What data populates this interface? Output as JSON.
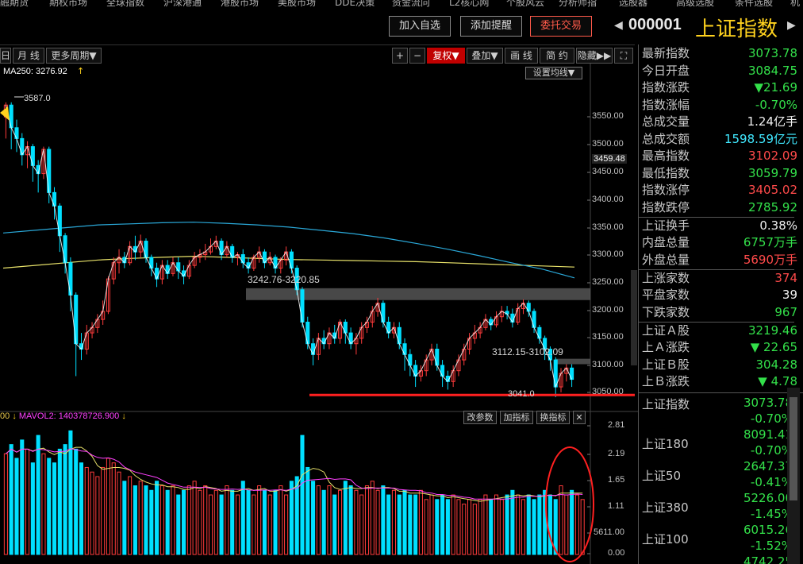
{
  "top_menu": [
    "融期货",
    "期权市场",
    "全球指数",
    "沪深港通",
    "港股市场",
    "美股市场",
    "DDE决策",
    "资金流向",
    "L2核心网",
    "个股风云",
    "分析师指",
    "选股器",
    "高级选股",
    "条件选股",
    "机"
  ],
  "header": {
    "buttons": [
      "加入自选",
      "添加提醒",
      "委托交易"
    ],
    "index_code": "000001",
    "index_name": "上证指数",
    "nav_prev": "◀",
    "nav_next": "▶"
  },
  "toolbar": {
    "left_items": [
      "日",
      "月 线",
      "更多周期▼"
    ],
    "right_items": [
      "+",
      "−",
      "复权▼",
      "叠加▼",
      "画 线",
      "简 约",
      "隐藏▶▶",
      "⛶"
    ],
    "active": "复权▼"
  },
  "ma": {
    "label": "MA250: 3276.92",
    "arrow": "↑",
    "settings_button": "设置均线▼"
  },
  "price_axis": [
    "3550.00",
    "3500.00",
    "3459.48",
    "3450.00",
    "3400.00",
    "3350.00",
    "3300.00",
    "3250.00",
    "3200.00",
    "3150.00",
    "3100.00",
    "3050.00"
  ],
  "annotations": {
    "high": "3587.0",
    "box_upper": "3242.76-3220.85",
    "box_lower": "3112.15-3102.09",
    "low": "3041.0"
  },
  "volume": {
    "header_prefix": "00",
    "header_arrow1": "↓",
    "header_label": "MAVOL2: 140378726.900",
    "header_arrow2": "↓",
    "buttons": [
      "改参数",
      "加指标",
      "换指标",
      "✕"
    ],
    "axis": [
      "2.81",
      "2.19",
      "1.65",
      "1.11",
      "5611.00",
      "0.00"
    ]
  },
  "colors": {
    "up": "#ff3b3b",
    "down": "#00e0ff",
    "ma_yellow": "#e8e26a",
    "ma_cyan": "#2aa8d8",
    "panel_up": "#ff4a4a",
    "panel_down": "#33e04a"
  },
  "panel": {
    "rows": [
      {
        "label": "最新指数",
        "value": "3073.78",
        "color": "down"
      },
      {
        "label": "今日开盘",
        "value": "3084.75",
        "color": "down"
      },
      {
        "label": "指数涨跌",
        "value": "▼21.69",
        "color": "down"
      },
      {
        "label": "指数涨幅",
        "value": "-0.70%",
        "color": "down"
      },
      {
        "label": "总成交量",
        "value": "1.24亿手",
        "color": "white"
      },
      {
        "label": "总成交额",
        "value": "1598.59亿元",
        "color": "cyan"
      },
      {
        "label": "最高指数",
        "value": "3102.09",
        "color": "up"
      },
      {
        "label": "最低指数",
        "value": "3059.79",
        "color": "down"
      },
      {
        "label": "指数涨停",
        "value": "3405.02",
        "color": "up"
      },
      {
        "label": "指数跌停",
        "value": "2785.92",
        "color": "down"
      },
      {
        "label": "上证换手",
        "value": "0.38%",
        "color": "white"
      },
      {
        "label": "内盘总量",
        "value": "6757万手",
        "color": "down"
      },
      {
        "label": "外盘总量",
        "value": "5690万手",
        "color": "up"
      },
      {
        "label": "上涨家数",
        "value": "374",
        "color": "up"
      },
      {
        "label": "平盘家数",
        "value": "39",
        "color": "white"
      },
      {
        "label": "下跌家数",
        "value": "967",
        "color": "down"
      },
      {
        "label": "上证Ａ股",
        "value": "3219.46",
        "color": "down"
      },
      {
        "label": "上Ａ涨跌",
        "value": "▼ 22.65",
        "color": "down"
      },
      {
        "label": "上证Ｂ股",
        "value": "304.28",
        "color": "down"
      },
      {
        "label": "上Ｂ涨跌",
        "value": "▼ 4.78",
        "color": "down"
      }
    ],
    "sub_indices": [
      {
        "label": "上证指数",
        "value": "3073.78",
        "pct": "-0.70%"
      },
      {
        "label": "上证180",
        "value": "8091.41",
        "pct": "-0.70%"
      },
      {
        "label": "上证50",
        "value": "2647.37",
        "pct": "-0.41%"
      },
      {
        "label": "上证380",
        "value": "5226.00",
        "pct": "-1.45%"
      },
      {
        "label": "上证100",
        "value": "6015.26",
        "pct": "-1.52%"
      },
      {
        "label": "上证150",
        "value": "4742.25",
        "pct": ""
      }
    ]
  },
  "chart_data": {
    "type": "candlestick",
    "price_range": [
      3041,
      3600
    ],
    "candles": [
      [
        3560,
        3582,
        3520,
        3587
      ],
      [
        3582,
        3540,
        3500,
        3587
      ],
      [
        3540,
        3520,
        3495,
        3555
      ],
      [
        3520,
        3490,
        3470,
        3530
      ],
      [
        3490,
        3505,
        3465,
        3515
      ],
      [
        3505,
        3470,
        3440,
        3510
      ],
      [
        3470,
        3455,
        3420,
        3480
      ],
      [
        3455,
        3500,
        3445,
        3505
      ],
      [
        3500,
        3420,
        3400,
        3505
      ],
      [
        3420,
        3395,
        3370,
        3430
      ],
      [
        3395,
        3340,
        3310,
        3400
      ],
      [
        3340,
        3290,
        3270,
        3345
      ],
      [
        3290,
        3230,
        3200,
        3300
      ],
      [
        3230,
        3140,
        3080,
        3235
      ],
      [
        3140,
        3130,
        3110,
        3160
      ],
      [
        3130,
        3160,
        3120,
        3175
      ],
      [
        3160,
        3170,
        3150,
        3180
      ],
      [
        3170,
        3185,
        3160,
        3195
      ],
      [
        3185,
        3200,
        3175,
        3220
      ],
      [
        3200,
        3260,
        3195,
        3265
      ],
      [
        3260,
        3290,
        3250,
        3300
      ],
      [
        3290,
        3300,
        3270,
        3315
      ],
      [
        3300,
        3290,
        3280,
        3310
      ],
      [
        3290,
        3320,
        3285,
        3330
      ],
      [
        3320,
        3310,
        3295,
        3340
      ],
      [
        3310,
        3330,
        3300,
        3342
      ],
      [
        3330,
        3300,
        3290,
        3335
      ],
      [
        3300,
        3280,
        3265,
        3305
      ],
      [
        3280,
        3260,
        3245,
        3290
      ],
      [
        3260,
        3285,
        3250,
        3295
      ],
      [
        3285,
        3270,
        3260,
        3295
      ],
      [
        3270,
        3290,
        3265,
        3300
      ],
      [
        3290,
        3275,
        3260,
        3300
      ],
      [
        3275,
        3265,
        3250,
        3285
      ],
      [
        3265,
        3285,
        3260,
        3295
      ],
      [
        3285,
        3300,
        3280,
        3310
      ],
      [
        3300,
        3305,
        3290,
        3315
      ],
      [
        3305,
        3310,
        3295,
        3325
      ],
      [
        3310,
        3320,
        3305,
        3335
      ],
      [
        3320,
        3330,
        3315,
        3340
      ],
      [
        3330,
        3305,
        3295,
        3335
      ],
      [
        3305,
        3320,
        3300,
        3330
      ],
      [
        3320,
        3300,
        3290,
        3325
      ],
      [
        3300,
        3305,
        3285,
        3310
      ],
      [
        3305,
        3290,
        3280,
        3315
      ],
      [
        3290,
        3280,
        3270,
        3300
      ],
      [
        3280,
        3300,
        3275,
        3305
      ],
      [
        3300,
        3310,
        3290,
        3320
      ],
      [
        3310,
        3290,
        3280,
        3315
      ],
      [
        3290,
        3300,
        3285,
        3310
      ],
      [
        3300,
        3280,
        3270,
        3305
      ],
      [
        3280,
        3295,
        3270,
        3300
      ],
      [
        3295,
        3310,
        3285,
        3320
      ],
      [
        3310,
        3280,
        3270,
        3315
      ],
      [
        3280,
        3240,
        3230,
        3285
      ],
      [
        3240,
        3180,
        3170,
        3245
      ],
      [
        3180,
        3140,
        3130,
        3190
      ],
      [
        3140,
        3120,
        3100,
        3150
      ],
      [
        3120,
        3150,
        3110,
        3160
      ],
      [
        3150,
        3140,
        3130,
        3165
      ],
      [
        3140,
        3160,
        3130,
        3170
      ],
      [
        3160,
        3150,
        3140,
        3175
      ],
      [
        3150,
        3180,
        3140,
        3185
      ],
      [
        3180,
        3160,
        3140,
        3185
      ],
      [
        3160,
        3140,
        3130,
        3170
      ],
      [
        3140,
        3150,
        3120,
        3160
      ],
      [
        3150,
        3170,
        3140,
        3180
      ],
      [
        3170,
        3180,
        3160,
        3190
      ],
      [
        3180,
        3200,
        3170,
        3210
      ],
      [
        3200,
        3215,
        3190,
        3225
      ],
      [
        3215,
        3180,
        3170,
        3220
      ],
      [
        3180,
        3160,
        3150,
        3190
      ],
      [
        3160,
        3170,
        3150,
        3180
      ],
      [
        3170,
        3140,
        3130,
        3180
      ],
      [
        3140,
        3120,
        3090,
        3150
      ],
      [
        3120,
        3100,
        3080,
        3130
      ],
      [
        3100,
        3080,
        3060,
        3110
      ],
      [
        3080,
        3090,
        3070,
        3100
      ],
      [
        3090,
        3110,
        3080,
        3120
      ],
      [
        3110,
        3130,
        3100,
        3140
      ],
      [
        3130,
        3100,
        3090,
        3140
      ],
      [
        3100,
        3080,
        3060,
        3110
      ],
      [
        3080,
        3070,
        3055,
        3090
      ],
      [
        3070,
        3090,
        3060,
        3100
      ],
      [
        3090,
        3110,
        3080,
        3120
      ],
      [
        3110,
        3130,
        3100,
        3140
      ],
      [
        3130,
        3150,
        3120,
        3160
      ],
      [
        3150,
        3160,
        3140,
        3175
      ],
      [
        3160,
        3170,
        3150,
        3180
      ],
      [
        3170,
        3185,
        3165,
        3195
      ],
      [
        3185,
        3175,
        3165,
        3190
      ],
      [
        3175,
        3190,
        3170,
        3200
      ],
      [
        3190,
        3200,
        3180,
        3210
      ],
      [
        3200,
        3195,
        3185,
        3210
      ],
      [
        3195,
        3180,
        3170,
        3205
      ],
      [
        3180,
        3205,
        3175,
        3215
      ],
      [
        3205,
        3215,
        3195,
        3222
      ],
      [
        3215,
        3200,
        3190,
        3220
      ],
      [
        3200,
        3170,
        3160,
        3205
      ],
      [
        3170,
        3150,
        3140,
        3175
      ],
      [
        3150,
        3130,
        3110,
        3155
      ],
      [
        3130,
        3110,
        3090,
        3135
      ],
      [
        3110,
        3060,
        3041,
        3115
      ],
      [
        3060,
        3085,
        3050,
        3095
      ],
      [
        3085,
        3095,
        3070,
        3102
      ],
      [
        3095,
        3074,
        3060,
        3102
      ]
    ],
    "ma_yellow": [
      3280,
      3285,
      3290,
      3295,
      3298,
      3300,
      3302,
      3300,
      3298,
      3296,
      3295,
      3294,
      3293,
      3292,
      3290,
      3288,
      3286,
      3284,
      3282
    ],
    "ma_cyan": [
      3345,
      3350,
      3355,
      3360,
      3362,
      3364,
      3365,
      3363,
      3360,
      3356,
      3350,
      3344,
      3336,
      3326,
      3315,
      3303,
      3290,
      3278,
      3262
    ],
    "volumes": [
      2.2,
      2.4,
      2.1,
      2.5,
      2.3,
      2.0,
      2.6,
      2.2,
      2.1,
      2.0,
      2.3,
      2.4,
      2.7,
      2.3,
      2.0,
      1.9,
      1.8,
      1.7,
      1.9,
      2.1,
      2.0,
      1.8,
      1.6,
      1.7,
      1.5,
      1.6,
      1.5,
      1.4,
      1.6,
      1.5,
      1.4,
      1.5,
      1.3,
      1.4,
      1.5,
      1.6,
      1.4,
      1.5,
      1.3,
      1.4,
      1.3,
      1.5,
      1.4,
      1.3,
      1.6,
      1.4,
      1.3,
      1.5,
      1.4,
      1.3,
      1.4,
      1.5,
      1.3,
      1.6,
      1.7,
      2.6,
      1.9,
      1.6,
      1.5,
      1.4,
      1.5,
      1.3,
      1.4,
      1.6,
      1.5,
      1.4,
      1.3,
      1.5,
      1.6,
      1.4,
      1.5,
      1.3,
      1.4,
      1.3,
      1.4,
      1.3,
      1.3,
      1.4,
      1.2,
      1.3,
      1.2,
      1.3,
      1.2,
      1.3,
      1.2,
      1.1,
      1.2,
      1.1,
      1.2,
      1.3,
      1.2,
      1.3,
      1.2,
      1.3,
      1.4,
      1.3,
      1.2,
      1.3,
      1.2,
      1.3,
      1.4,
      1.3,
      1.2,
      1.5,
      1.3,
      1.4,
      1.3,
      1.2
    ],
    "vol_range": [
      0,
      2.81
    ]
  }
}
